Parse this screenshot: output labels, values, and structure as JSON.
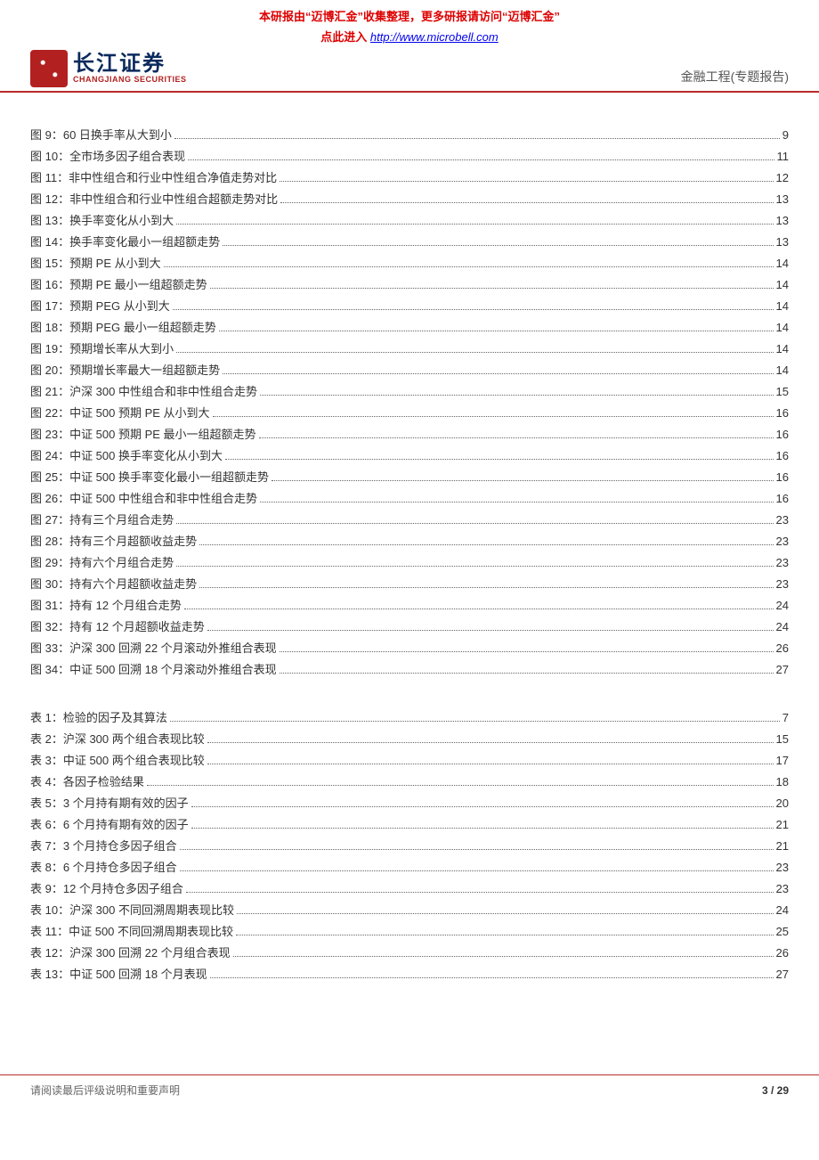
{
  "watermark": {
    "line1": "本研报由“迈博汇金”收集整理，更多研报请访问“迈博汇金”",
    "line2_prefix": "点此进入 ",
    "link_text": "http://www.microbell.com"
  },
  "header": {
    "logo_cn": "长江证券",
    "logo_en": "CHANGJIANG SECURITIES",
    "report_type": "金融工程(专题报告)"
  },
  "toc_figures": [
    {
      "label": "图 9：60 日换手率从大到小",
      "page": "9"
    },
    {
      "label": "图 10：全市场多因子组合表现",
      "page": "11"
    },
    {
      "label": "图 11：非中性组合和行业中性组合净值走势对比",
      "page": "12"
    },
    {
      "label": "图 12：非中性组合和行业中性组合超额走势对比",
      "page": "13"
    },
    {
      "label": "图 13：换手率变化从小到大",
      "page": "13"
    },
    {
      "label": "图 14：换手率变化最小一组超额走势",
      "page": "13"
    },
    {
      "label": "图 15：预期 PE 从小到大",
      "page": "14"
    },
    {
      "label": "图 16：预期 PE 最小一组超额走势",
      "page": "14"
    },
    {
      "label": "图 17：预期 PEG 从小到大",
      "page": "14"
    },
    {
      "label": "图 18：预期 PEG 最小一组超额走势",
      "page": "14"
    },
    {
      "label": "图 19：预期增长率从大到小",
      "page": "14"
    },
    {
      "label": "图 20：预期增长率最大一组超额走势",
      "page": "14"
    },
    {
      "label": "图 21：沪深 300 中性组合和非中性组合走势",
      "page": "15"
    },
    {
      "label": "图 22：中证 500 预期 PE 从小到大",
      "page": "16"
    },
    {
      "label": "图 23：中证 500 预期 PE 最小一组超额走势",
      "page": "16"
    },
    {
      "label": "图 24：中证 500 换手率变化从小到大",
      "page": "16"
    },
    {
      "label": "图 25：中证 500 换手率变化最小一组超额走势",
      "page": "16"
    },
    {
      "label": "图 26：中证 500 中性组合和非中性组合走势",
      "page": "16"
    },
    {
      "label": "图 27：持有三个月组合走势",
      "page": "23"
    },
    {
      "label": "图 28：持有三个月超额收益走势",
      "page": "23"
    },
    {
      "label": "图 29：持有六个月组合走势",
      "page": "23"
    },
    {
      "label": "图 30：持有六个月超额收益走势",
      "page": "23"
    },
    {
      "label": "图 31：持有 12 个月组合走势",
      "page": "24"
    },
    {
      "label": "图 32：持有 12 个月超额收益走势",
      "page": "24"
    },
    {
      "label": "图 33：沪深 300 回溯 22 个月滚动外推组合表现",
      "page": "26"
    },
    {
      "label": "图 34：中证 500 回溯 18 个月滚动外推组合表现",
      "page": "27"
    }
  ],
  "toc_tables": [
    {
      "label": "表 1：检验的因子及其算法",
      "page": "7"
    },
    {
      "label": "表 2：沪深 300 两个组合表现比较",
      "page": "15"
    },
    {
      "label": "表 3：中证 500 两个组合表现比较",
      "page": "17"
    },
    {
      "label": "表 4：各因子检验结果",
      "page": "18"
    },
    {
      "label": "表 5：3 个月持有期有效的因子",
      "page": "20"
    },
    {
      "label": "表 6：6 个月持有期有效的因子",
      "page": "21"
    },
    {
      "label": "表 7：3 个月持仓多因子组合",
      "page": "21"
    },
    {
      "label": "表 8：6 个月持仓多因子组合",
      "page": "23"
    },
    {
      "label": "表 9：12 个月持仓多因子组合",
      "page": "23"
    },
    {
      "label": "表 10：沪深 300 不同回溯周期表现比较",
      "page": "24"
    },
    {
      "label": "表 11：中证 500 不同回溯周期表现比较",
      "page": "25"
    },
    {
      "label": "表 12：沪深 300 回溯 22 个月组合表现",
      "page": "26"
    },
    {
      "label": "表 13：中证 500 回溯 18 个月表现",
      "page": "27"
    }
  ],
  "footer": {
    "disclaimer": "请阅读最后评级说明和重要声明",
    "page_current": "3",
    "page_sep": " / ",
    "page_total": "29"
  }
}
